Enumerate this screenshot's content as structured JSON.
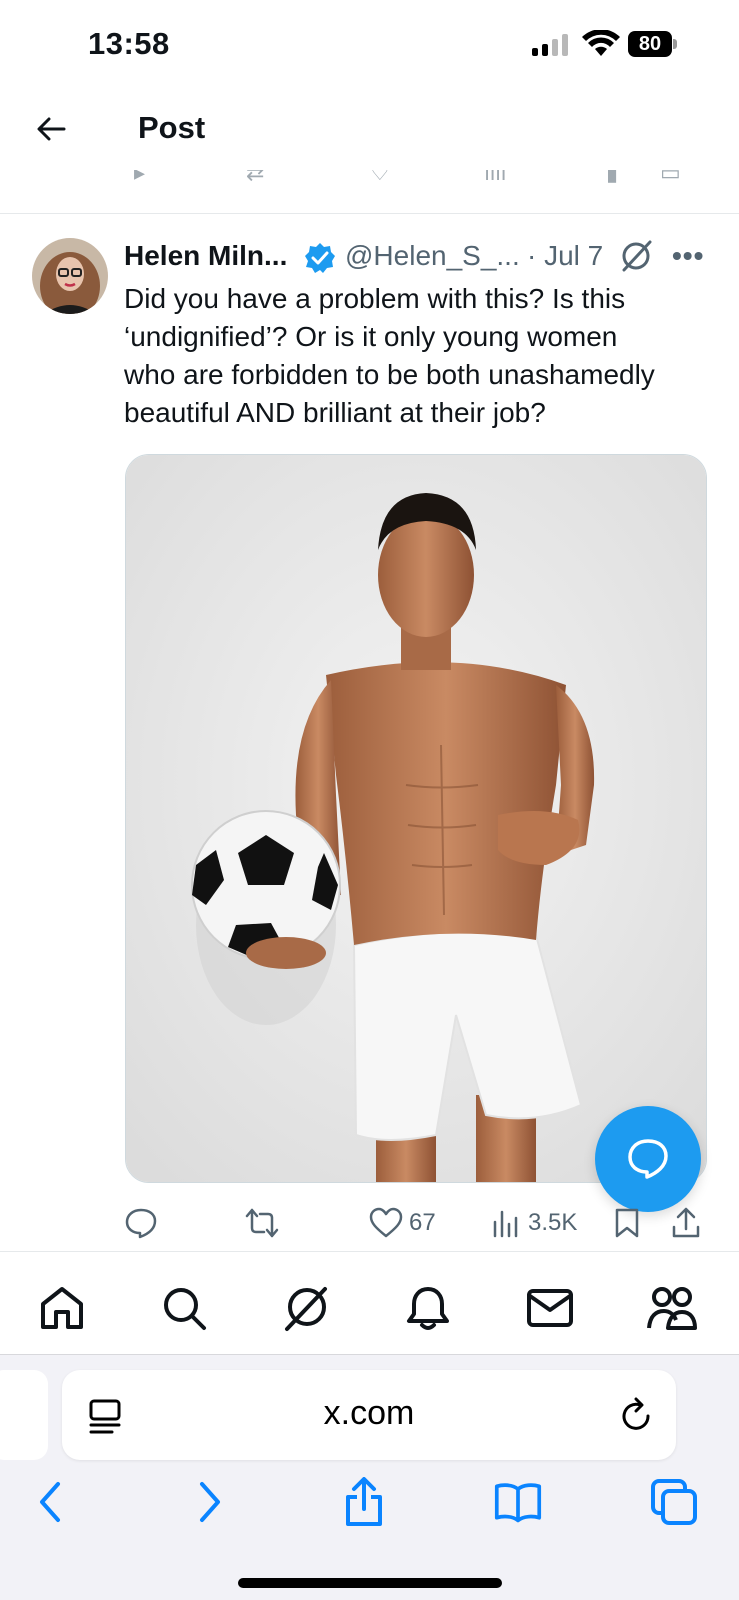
{
  "status_bar": {
    "time": "13:58",
    "battery": "80"
  },
  "header": {
    "title": "Post"
  },
  "post": {
    "author_name": "Helen Miln...",
    "author_handle": "@Helen_S_...",
    "date": "· Jul 7",
    "text": [
      "Did you have a problem with this? Is this",
      "‘undignified’? Or is it only young women",
      "who are forbidden to be both unashamedly",
      "beautiful AND brilliant at their job?"
    ],
    "likes": "67",
    "views": "3.5K"
  },
  "browser": {
    "url": "x.com"
  },
  "colors": {
    "accent": "#1d9bf0",
    "text_secondary": "#536471",
    "safari_blue": "#0a84ff"
  },
  "icons": {
    "tabs": [
      "home-icon",
      "search-icon",
      "grok-icon",
      "notifications-bell-icon",
      "messages-envelope-icon",
      "communities-icon"
    ],
    "actions": [
      "reply-icon",
      "repost-icon",
      "like-heart-icon",
      "views-chart-icon",
      "bookmark-icon",
      "share-icon"
    ]
  }
}
